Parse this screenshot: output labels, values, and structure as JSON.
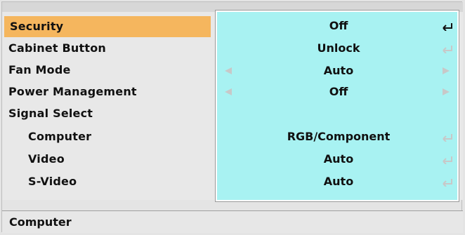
{
  "menu": {
    "items": [
      {
        "label": "Security",
        "value": "Off",
        "selected": true,
        "has_enter": true,
        "has_arrows": false,
        "indent": false
      },
      {
        "label": "Cabinet Button",
        "value": "Unlock",
        "selected": false,
        "has_enter": true,
        "has_arrows": false,
        "indent": false
      },
      {
        "label": "Fan Mode",
        "value": "Auto",
        "selected": false,
        "has_enter": false,
        "has_arrows": true,
        "indent": false
      },
      {
        "label": "Power Management",
        "value": "Off",
        "selected": false,
        "has_enter": false,
        "has_arrows": true,
        "indent": false
      },
      {
        "label": "Signal Select",
        "value": "",
        "selected": false,
        "has_enter": false,
        "has_arrows": false,
        "indent": false
      },
      {
        "label": "Computer",
        "value": "RGB/Component",
        "selected": false,
        "has_enter": true,
        "has_arrows": false,
        "indent": true
      },
      {
        "label": "Video",
        "value": "Auto",
        "selected": false,
        "has_enter": true,
        "has_arrows": false,
        "indent": true
      },
      {
        "label": "S-Video",
        "value": "Auto",
        "selected": false,
        "has_enter": true,
        "has_arrows": false,
        "indent": true
      }
    ]
  },
  "status": {
    "text": "Computer"
  },
  "colors": {
    "selected_label_bg": "#f5b65e",
    "value_panel_bg": "#a8f2f2",
    "active_icon": "#111111",
    "inactive_icon": "#c8c8c8"
  }
}
